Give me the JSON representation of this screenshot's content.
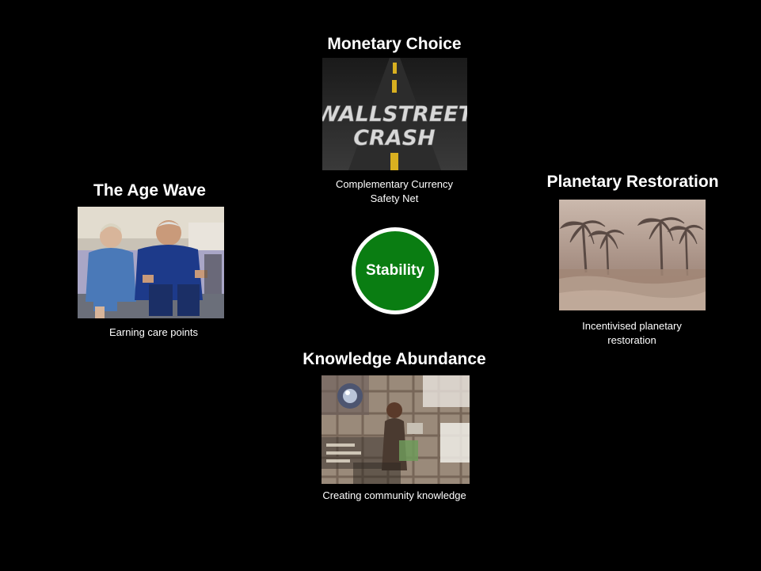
{
  "center": {
    "label": "Stability",
    "color": "#0a7d12"
  },
  "panels": {
    "monetary_choice": {
      "title": "Monetary Choice",
      "image_text_line1": "WALLSTREET",
      "image_text_line2": "CRASH",
      "caption_line1": "Complementary Currency",
      "caption_line2": "Safety Net"
    },
    "age_wave": {
      "title": "The Age Wave",
      "caption_line1": "Earning care points"
    },
    "planetary_restoration": {
      "title": "Planetary Restoration",
      "caption_line1": "Incentivised planetary",
      "caption_line2": "restoration"
    },
    "knowledge_abundance": {
      "title": "Knowledge Abundance",
      "caption_line1": "Creating community knowledge"
    }
  }
}
